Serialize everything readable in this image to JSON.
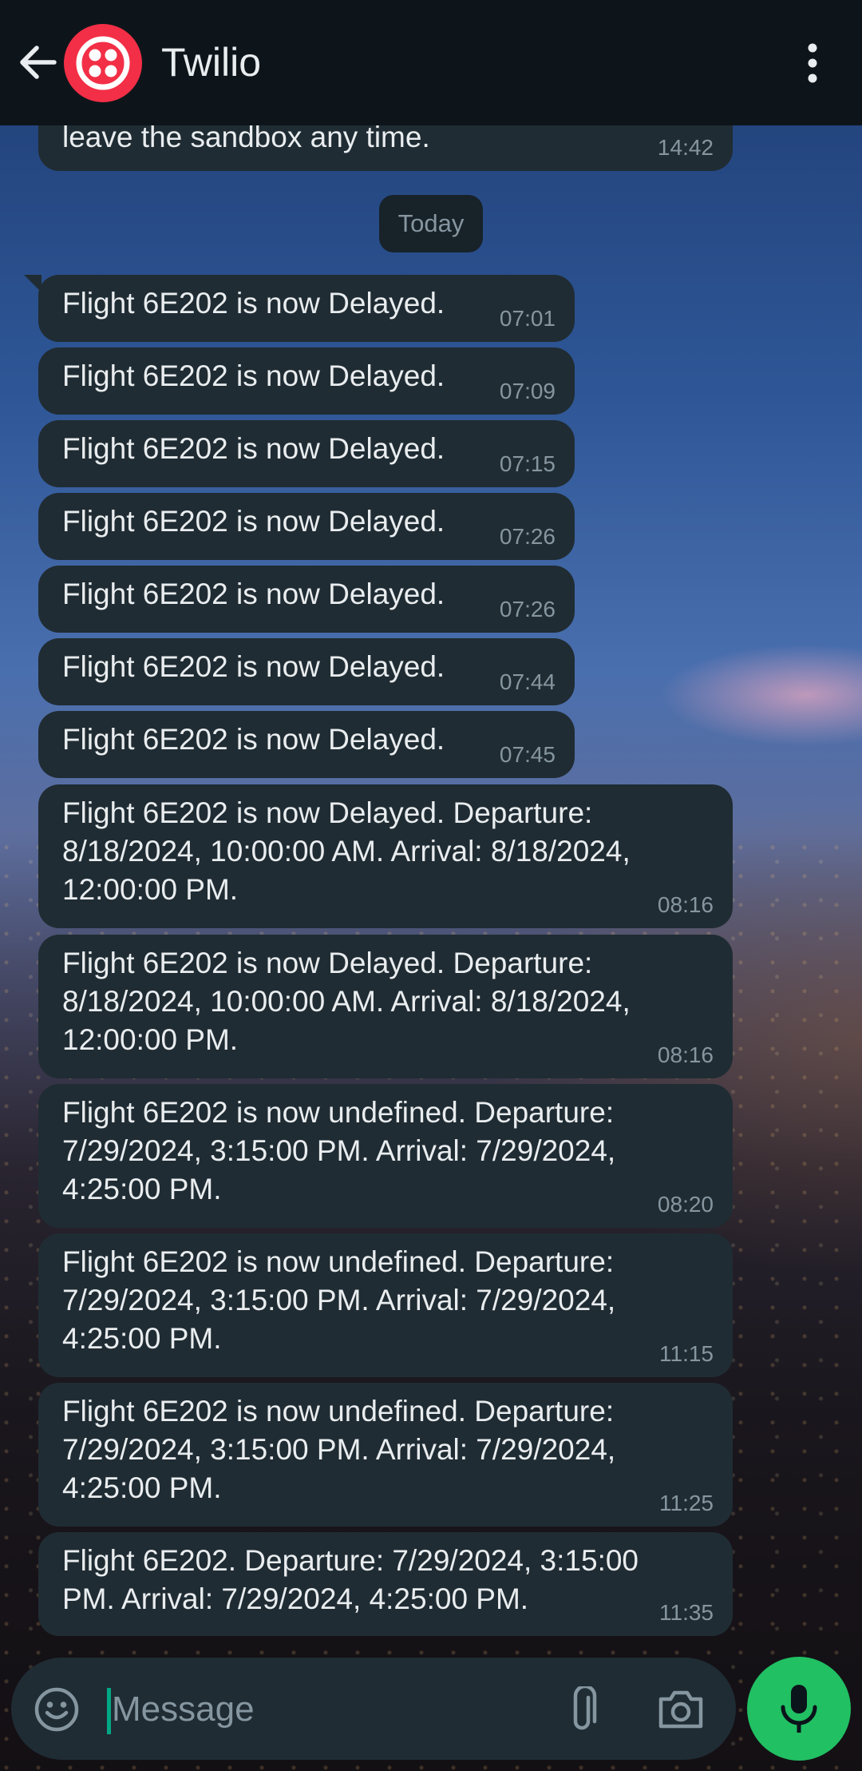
{
  "header": {
    "title": "Twilio"
  },
  "chat": {
    "date_chip": "Today",
    "messages": [
      {
        "text": "leave the sandbox any time.",
        "time": "14:42"
      },
      {
        "text": "Flight 6E202 is now Delayed.",
        "time": "07:01"
      },
      {
        "text": "Flight 6E202 is now Delayed.",
        "time": "07:09"
      },
      {
        "text": "Flight 6E202 is now Delayed.",
        "time": "07:15"
      },
      {
        "text": "Flight 6E202 is now Delayed.",
        "time": "07:26"
      },
      {
        "text": "Flight 6E202 is now Delayed.",
        "time": "07:26"
      },
      {
        "text": "Flight 6E202 is now Delayed.",
        "time": "07:44"
      },
      {
        "text": "Flight 6E202 is now Delayed.",
        "time": "07:45"
      },
      {
        "text": "Flight 6E202 is now Delayed. Departure:\n8/18/2024, 10:00:00 AM. Arrival: 8/18/2024,\n12:00:00 PM.",
        "time": "08:16"
      },
      {
        "text": "Flight 6E202 is now Delayed. Departure:\n8/18/2024, 10:00:00 AM. Arrival: 8/18/2024,\n12:00:00 PM.",
        "time": "08:16"
      },
      {
        "text": "Flight 6E202 is now undefined. Departure:\n7/29/2024, 3:15:00 PM. Arrival: 7/29/2024,\n4:25:00 PM.",
        "time": "08:20"
      },
      {
        "text": "Flight 6E202 is now undefined. Departure:\n7/29/2024, 3:15:00 PM. Arrival: 7/29/2024,\n4:25:00 PM.",
        "time": "11:15"
      },
      {
        "text": "Flight 6E202 is now undefined. Departure:\n7/29/2024, 3:15:00 PM. Arrival: 7/29/2024,\n4:25:00 PM.",
        "time": "11:25"
      },
      {
        "text": "Flight 6E202. Departure: 7/29/2024, 3:15:00\nPM. Arrival: 7/29/2024, 4:25:00 PM.",
        "time": "11:35"
      }
    ]
  },
  "composer": {
    "placeholder": "Message"
  },
  "icons": {
    "back": "arrow-left-icon",
    "avatar": "twilio-logo",
    "menu": "more-vert-icon",
    "emoji": "emoji-icon",
    "attach": "paperclip-icon",
    "camera": "camera-icon",
    "mic": "mic-icon"
  },
  "colors": {
    "header_bg": "#0d151b",
    "bubble_bg": "#202c33",
    "accent_green": "#21c063",
    "twilio_red": "#f22f46"
  }
}
